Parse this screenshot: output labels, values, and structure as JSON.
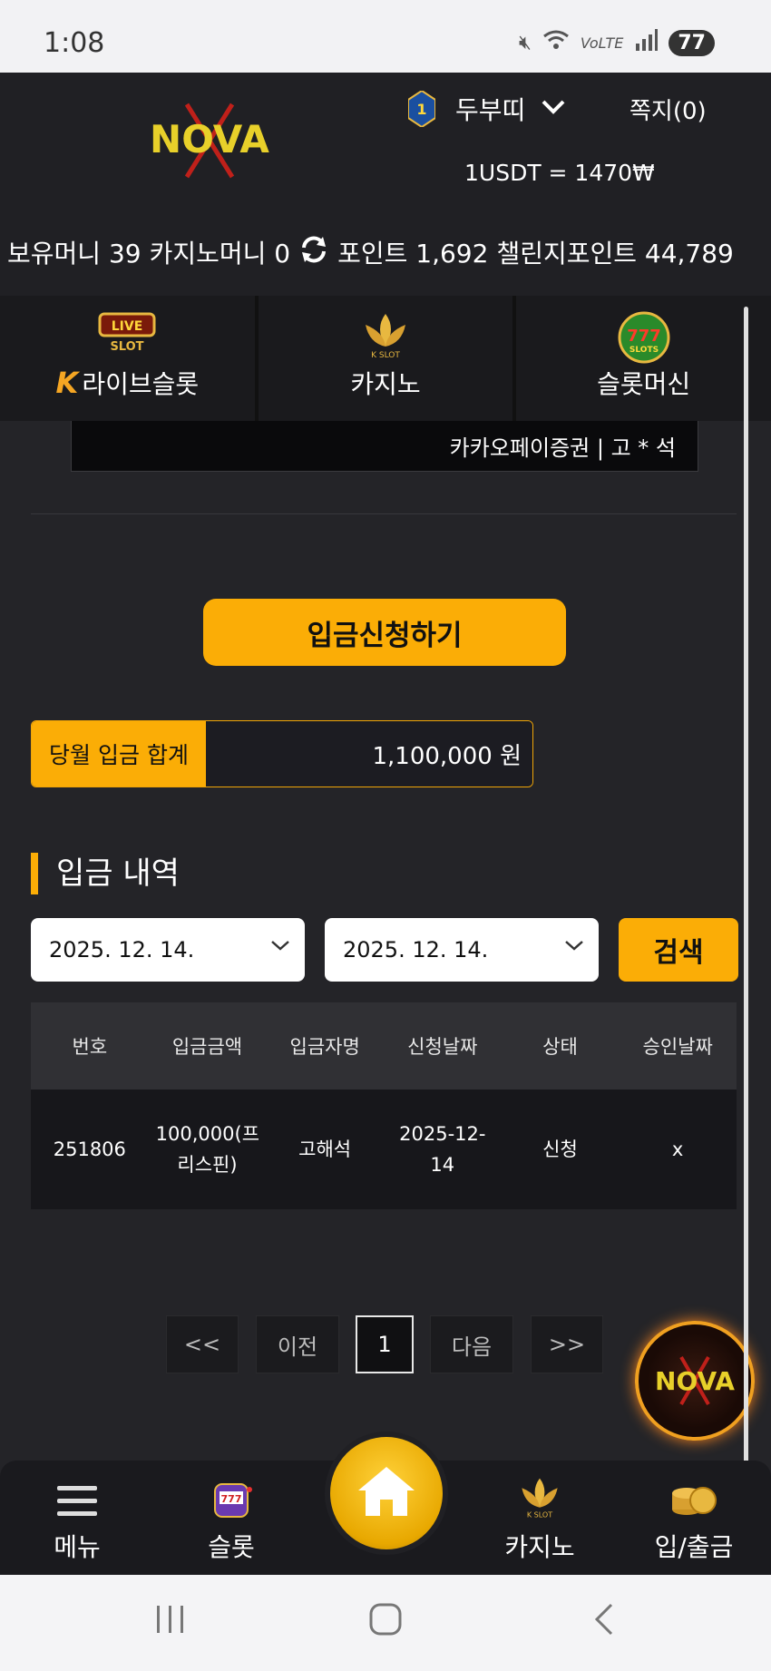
{
  "status_bar": {
    "time": "1:08",
    "battery": "77"
  },
  "header": {
    "logo_text": "NOVA",
    "level": "1",
    "username": "두부띠",
    "messages": "쪽지(0)",
    "rate": "1USDT = 1470₩",
    "balances": {
      "money": "보유머니 39",
      "casino_money": "카지노머니 0",
      "points": "포인트 1,692",
      "challenge_points": "챌린지포인트 44,789"
    }
  },
  "tabs": [
    {
      "label": "라이브슬롯",
      "badge": "K"
    },
    {
      "label": "카지노"
    },
    {
      "label": "슬롯머신"
    }
  ],
  "notice": "카카오페이증권 | 고 * 석",
  "deposit_button": "입금신청하기",
  "monthly": {
    "label": "당월 입금 합계",
    "value": "1,100,000 원"
  },
  "history": {
    "title": "입금 내역",
    "date_from": "2025. 12. 14.",
    "date_to": "2025. 12. 14.",
    "search": "검색",
    "columns": [
      "번호",
      "입금금액",
      "입금자명",
      "신청날짜",
      "상태",
      "승인날짜"
    ],
    "rows": [
      [
        "251806",
        "100,000(프리스핀)",
        "고해석",
        "2025-12-14",
        "신청",
        "x"
      ]
    ]
  },
  "pagination": {
    "first": "<<",
    "prev": "이전",
    "current": "1",
    "next": "다음",
    "last": ">>"
  },
  "bottom_nav": {
    "menu": "메뉴",
    "slot": "슬롯",
    "casino": "카지노",
    "deposit": "입/출금"
  },
  "colors": {
    "accent": "#fbad06",
    "background": "#242428"
  }
}
